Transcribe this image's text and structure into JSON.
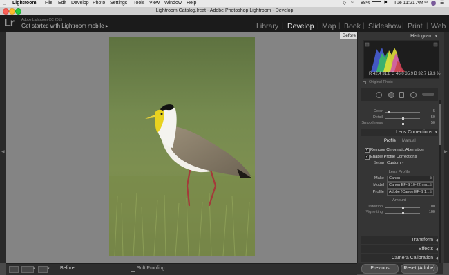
{
  "menubar": {
    "items": [
      "Lightroom",
      "File",
      "Edit",
      "Develop",
      "Photo",
      "Settings",
      "Tools",
      "View",
      "Window",
      "Help"
    ],
    "battery": "88%",
    "time": "Tue 11:21 AM"
  },
  "window": {
    "title": "Lightroom Catalog.lrcat - Adobe Photoshop Lightroom - Develop"
  },
  "identity": {
    "logo": "Lr",
    "version": "Adobe Lightroom CC 2015",
    "mobile": "Get started with Lightroom mobile ▸"
  },
  "modules": [
    "Library",
    "Develop",
    "Map",
    "Book",
    "Slideshow",
    "Print",
    "Web"
  ],
  "active_module": "Develop",
  "canvas": {
    "badge": "Before"
  },
  "toolbar": {
    "before_label": "Before",
    "soft_proofing": "Soft Proofing"
  },
  "panel": {
    "histogram_title": "Histogram",
    "histogram_values": "R  42.4  31.8  G  46.0  35.9  B  32.7  19.3  %",
    "original_photo": "Original Photo",
    "sliders": [
      {
        "label": "Color",
        "value": "5",
        "pos": 0.1
      },
      {
        "label": "Detail",
        "value": "50",
        "pos": 0.5
      },
      {
        "label": "Smoothness",
        "value": "50",
        "pos": 0.5
      }
    ],
    "lens_title": "Lens Corrections",
    "tabs": [
      "Profile",
      "Manual"
    ],
    "remove_ca": "Remove Chromatic Aberration",
    "enable_profile": "Enable Profile Corrections",
    "setup_label": "Setup",
    "setup_value": "Custom",
    "lens_profile_label": "Lens Profile",
    "make_label": "Make",
    "make_value": "Canon",
    "model_label": "Model",
    "model_value": "Canon EF-S 10-22mm...",
    "profile_label": "Profile",
    "profile_value": "Adobe (Canon EF-S 1...",
    "amount_label": "Amount",
    "amount_sliders": [
      {
        "label": "Distortion",
        "value": "100",
        "pos": 0.5
      },
      {
        "label": "Vignetting",
        "value": "100",
        "pos": 0.5
      }
    ],
    "transform_title": "Transform",
    "effects_title": "Effects",
    "calibration_title": "Camera Calibration",
    "previous_button": "Previous",
    "reset_button": "Reset (Adobe)"
  },
  "colors": {
    "active_module": "#e8e8e8",
    "inactive_module": "#8e8e8e"
  }
}
